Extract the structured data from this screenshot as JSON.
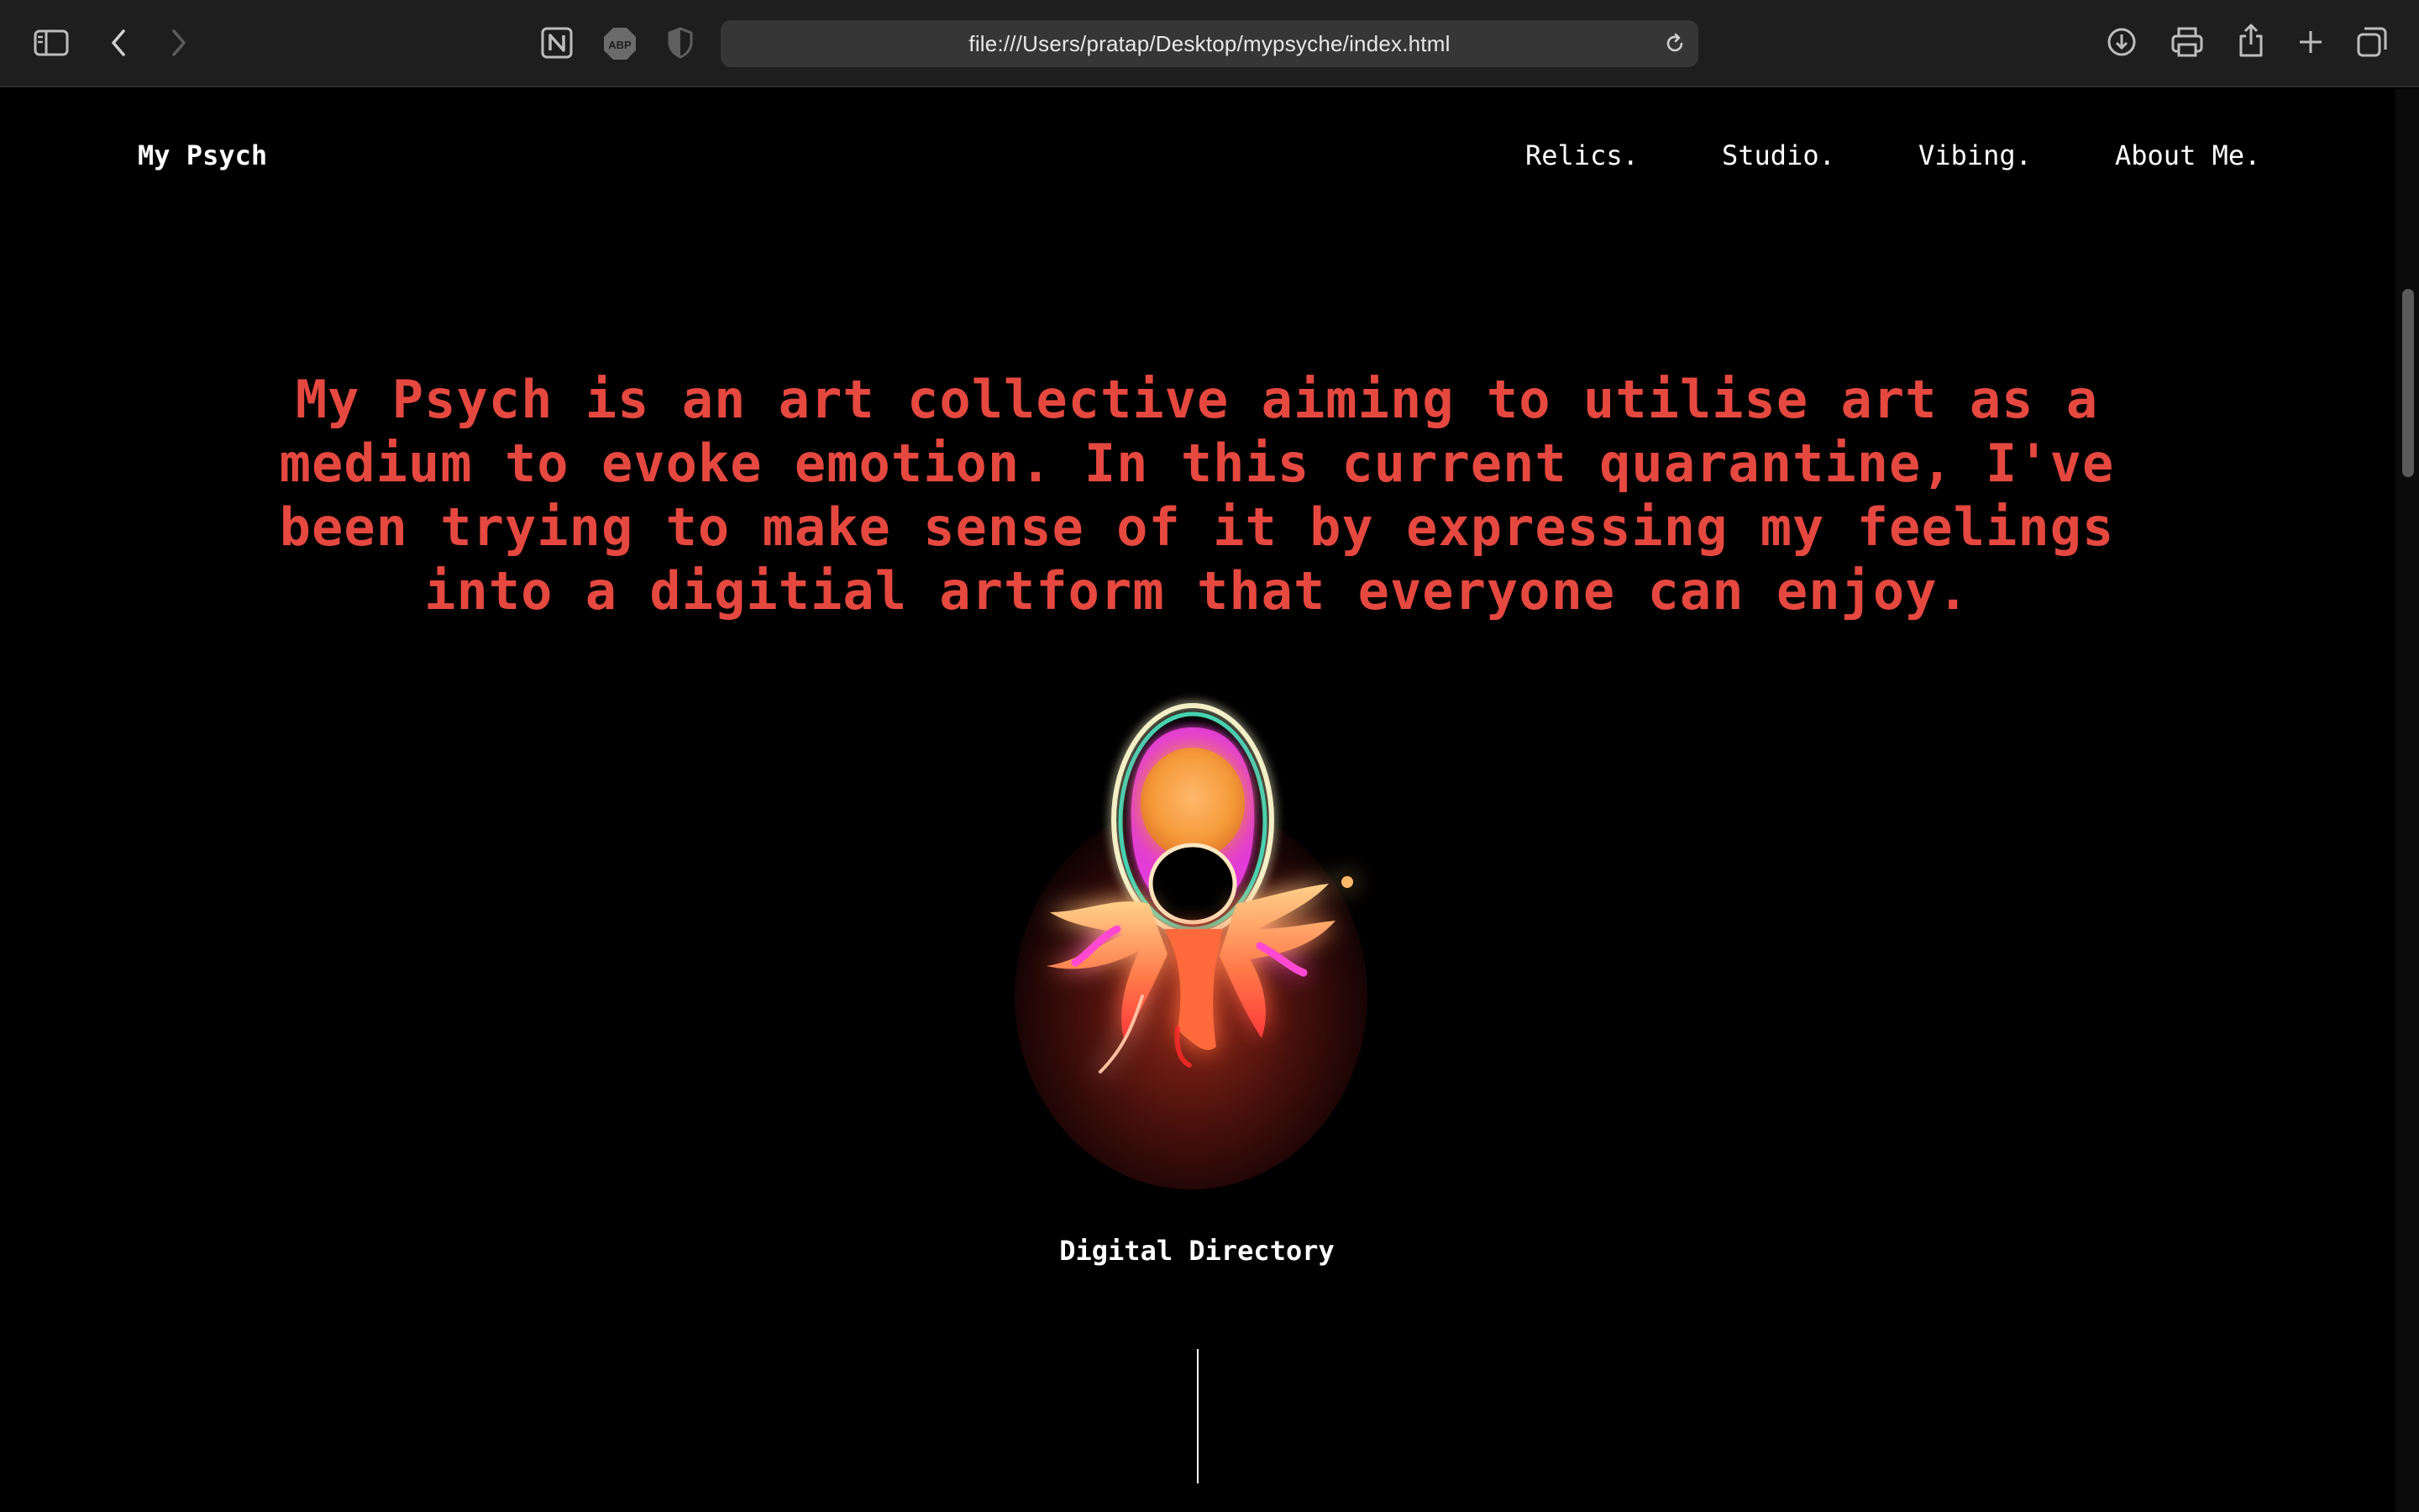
{
  "browser": {
    "url": "file:///Users/pratap/Desktop/mypsyche/index.html",
    "icons": [
      "sidebar-icon",
      "back-icon",
      "forward-icon",
      "notion-icon",
      "adblock-icon",
      "privacy-shield-icon",
      "reload-icon",
      "downloads-icon",
      "print-icon",
      "share-icon",
      "new-tab-icon",
      "tab-overview-icon"
    ],
    "adblock_label": "ABP"
  },
  "site": {
    "brand": "My Psych",
    "nav": [
      "Relics.",
      "Studio.",
      "Vibing.",
      "About Me."
    ],
    "hero_lines": [
      "My Psych is an art collective aiming to utilise art as a",
      "medium to evoke emotion. In this current quarantine, I've",
      "been trying to make sense of it by expressing my feelings",
      "into a digitial artform that everyone can enjoy."
    ],
    "section_title": "Digital Directory"
  },
  "colors": {
    "background": "#000000",
    "accent": "#e5483f",
    "chrome": "#1e1e1e"
  }
}
